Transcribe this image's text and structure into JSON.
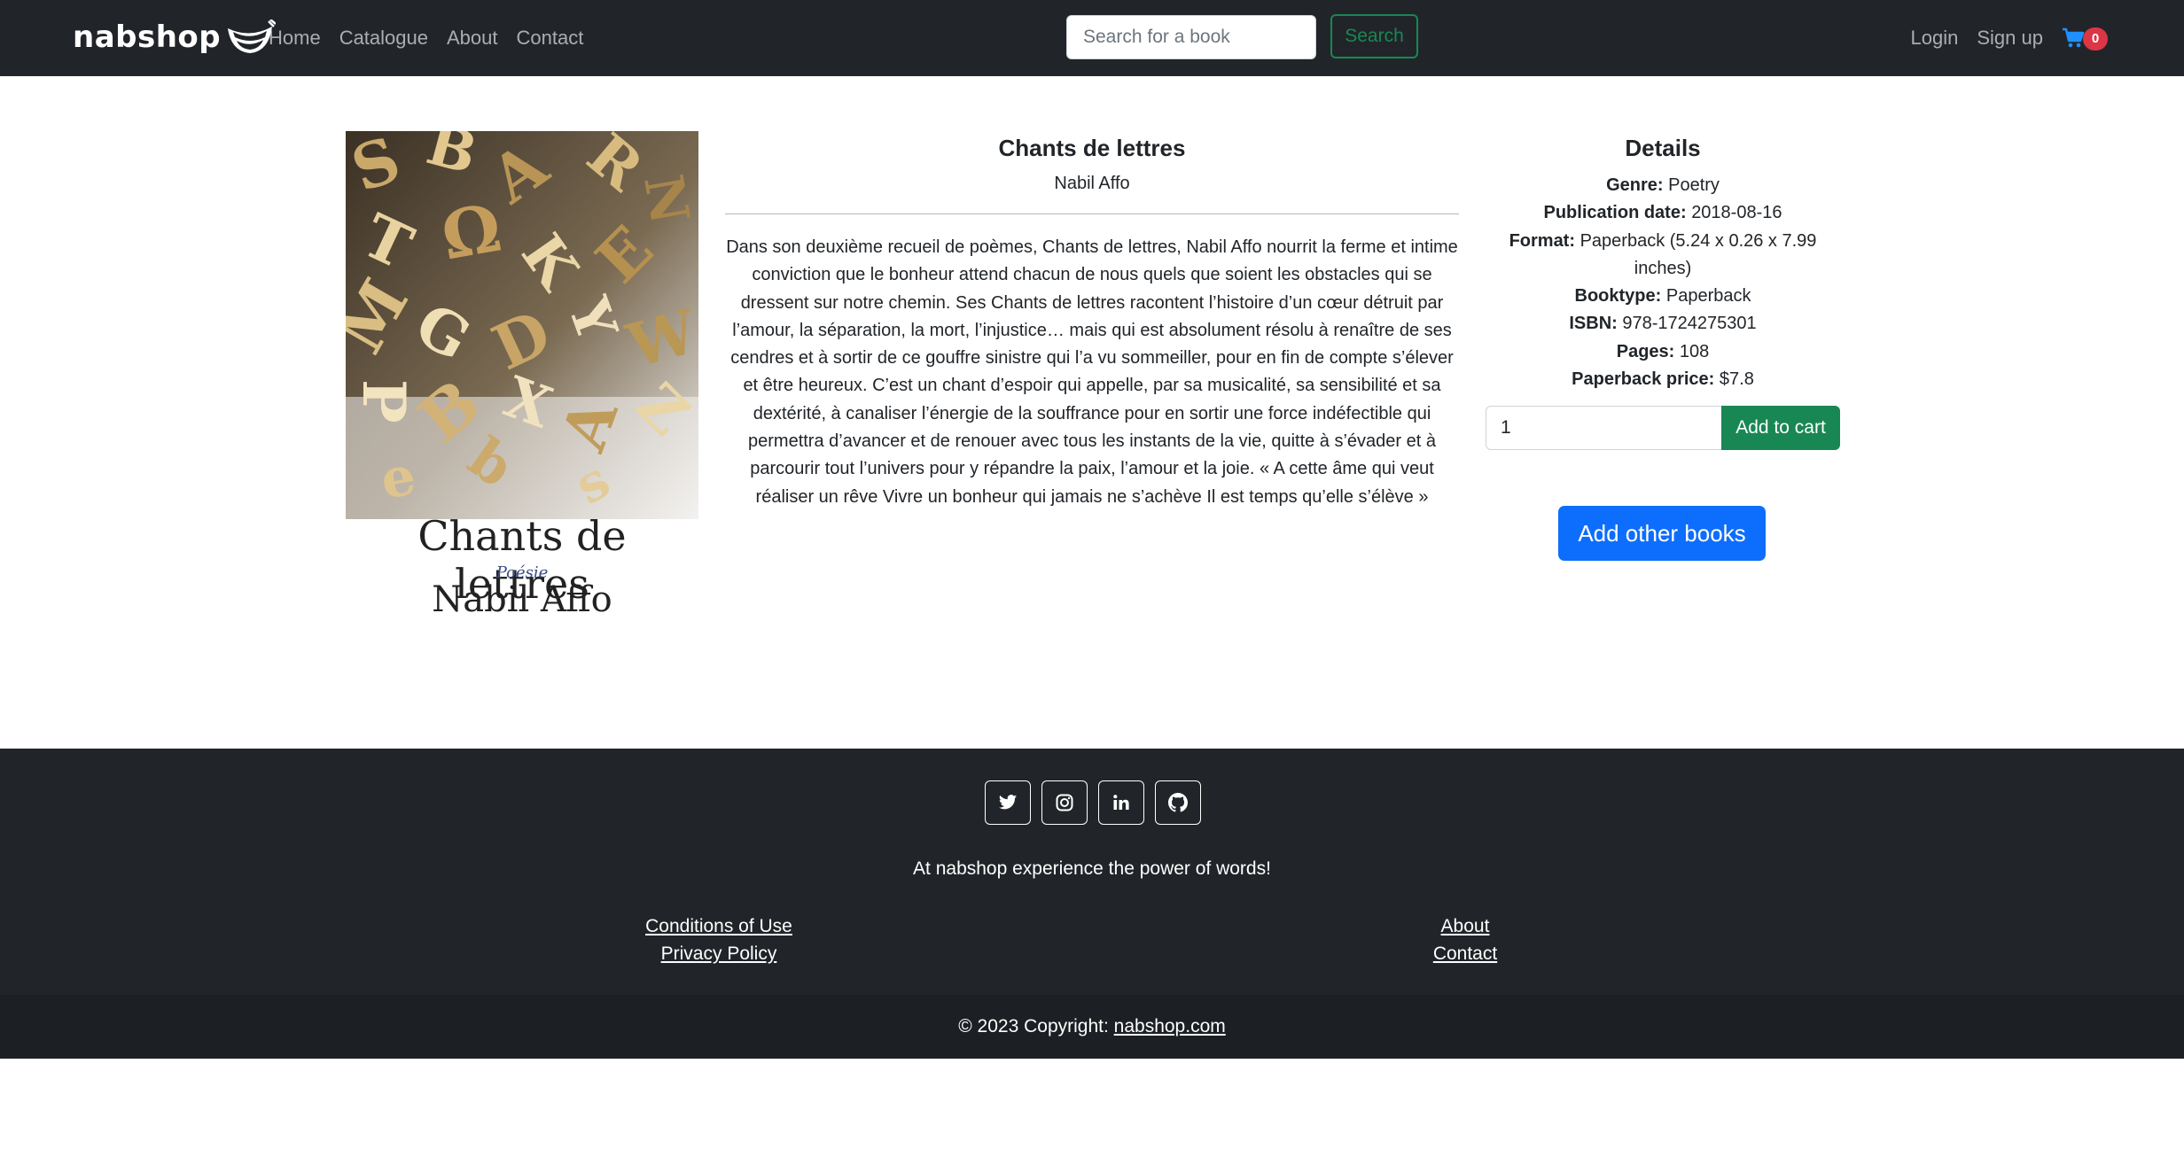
{
  "navbar": {
    "brand": "nabshop",
    "links": [
      "Home",
      "Catalogue",
      "About",
      "Contact"
    ],
    "search_placeholder": "Search for a book",
    "search_label": "Search",
    "login": "Login",
    "signup": "Sign up",
    "cart_count": "0"
  },
  "book": {
    "cover_title": "Chants de lettres",
    "cover_subtitle": "Poésie",
    "cover_author": "Nabil Affo",
    "title": "Chants de lettres",
    "author": "Nabil Affo",
    "description": "Dans son deuxième recueil de poèmes, Chants de lettres, Nabil Affo nourrit la ferme et intime conviction que le bonheur attend chacun de nous quels que soient les obstacles qui se dressent sur notre chemin. Ses Chants de lettres racontent l’histoire d’un cœur détruit par l’amour, la séparation, la mort, l’injustice… mais qui est absolument résolu à renaître de ses cendres et à sortir de ce gouffre sinistre qui l’a vu sommeiller, pour en fin de compte s’élever et être heureux. C’est un chant d’espoir qui appelle, par sa musicalité, sa sensibilité et sa dextérité, à canaliser l’énergie de la souffrance pour en sortir une force indéfectible qui permettra d’avancer et de renouer avec tous les instants de la vie, quitte à s’évader et à parcourir tout l’univers pour y répandre la paix, l’amour et la joie. « A cette âme qui veut réaliser un rêve Vivre un bonheur qui jamais ne s’achève Il est temps qu’elle s’élève »"
  },
  "details": {
    "heading": "Details",
    "genre_label": "Genre:",
    "genre": "Poetry",
    "pubdate_label": "Publication date:",
    "pubdate": "2018-08-16",
    "format_label": "Format:",
    "format": "Paperback (5.24 x 0.26 x 7.99 inches)",
    "booktype_label": "Booktype:",
    "booktype": "Paperback",
    "isbn_label": "ISBN:",
    "isbn": "978-1724275301",
    "pages_label": "Pages:",
    "pages": "108",
    "price_label": "Paperback price:",
    "price": "$7.8",
    "quantity": "1",
    "add_to_cart": "Add to cart",
    "add_other": "Add other books"
  },
  "footer": {
    "tagline": "At nabshop experience the power of words!",
    "conditions": "Conditions of Use",
    "privacy": "Privacy Policy",
    "about": "About",
    "contact": "Contact",
    "copyright": "© 2023 Copyright: ",
    "copyright_link": "nabshop.com",
    "socials": [
      "twitter-icon",
      "instagram-icon",
      "linkedin-icon",
      "github-icon"
    ]
  },
  "colors": {
    "navbar_bg": "#212529",
    "success": "#198754",
    "primary": "#0d6efd",
    "danger": "#dc3545"
  }
}
